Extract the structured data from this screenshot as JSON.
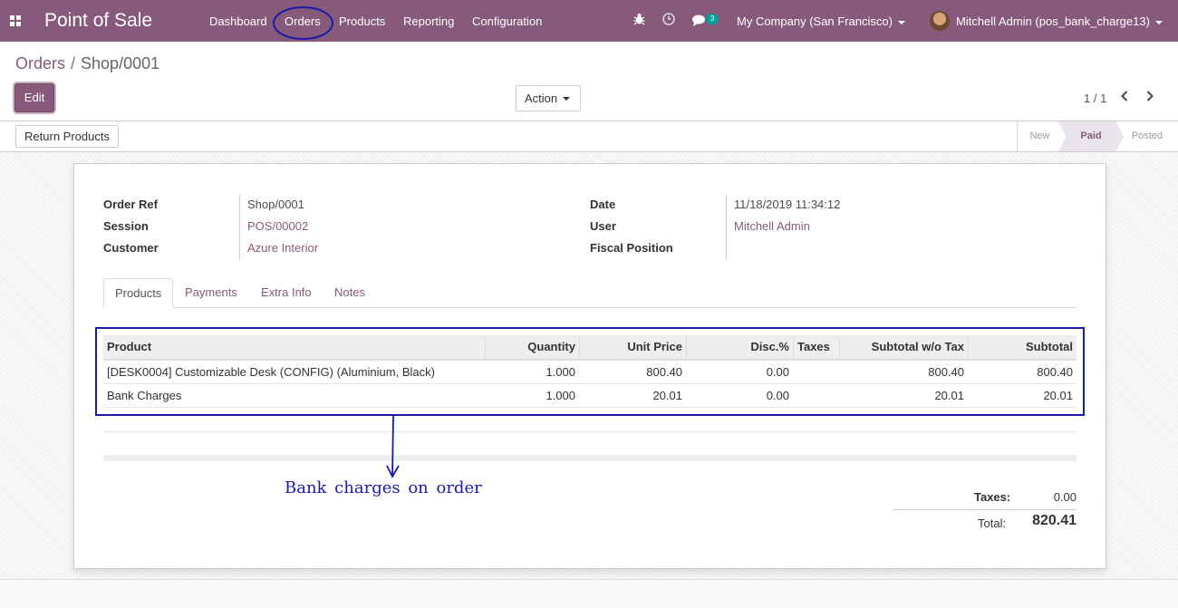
{
  "navbar": {
    "app_title": "Point of Sale",
    "menu": [
      "Dashboard",
      "Orders",
      "Products",
      "Reporting",
      "Configuration"
    ],
    "messages_count": "3",
    "company": "My Company (San Francisco)",
    "user": "Mitchell Admin (pos_bank_charge13)",
    "icons": [
      "apps-icon",
      "bug-icon",
      "clock-icon",
      "chat-icon"
    ]
  },
  "breadcrumb": {
    "parent": "Orders",
    "separator": "/",
    "current": "Shop/0001"
  },
  "toolbar": {
    "edit_label": "Edit",
    "action_label": "Action",
    "pager": "1 / 1",
    "prev_icon": "‹",
    "next_icon": "›"
  },
  "statusbar": {
    "return_label": "Return Products",
    "states": [
      "New",
      "Paid",
      "Posted"
    ],
    "active_state": "Paid"
  },
  "form": {
    "left": [
      {
        "label": "Order Ref",
        "value": "Shop/0001",
        "link": false
      },
      {
        "label": "Session",
        "value": "POS/00002",
        "link": true
      },
      {
        "label": "Customer",
        "value": "Azure Interior",
        "link": true
      }
    ],
    "right": [
      {
        "label": "Date",
        "value": "11/18/2019 11:34:12",
        "link": false
      },
      {
        "label": "User",
        "value": "Mitchell Admin",
        "link": true
      },
      {
        "label": "Fiscal Position",
        "value": "",
        "link": false
      }
    ]
  },
  "tabs": [
    "Products",
    "Payments",
    "Extra Info",
    "Notes"
  ],
  "active_tab": "Products",
  "table": {
    "headers": [
      "Product",
      "Quantity",
      "Unit Price",
      "Disc.%",
      "Taxes",
      "Subtotal w/o Tax",
      "Subtotal"
    ],
    "rows": [
      [
        "[DESK0004] Customizable Desk (CONFIG) (Aluminium, Black)",
        "1.000",
        "800.40",
        "0.00",
        "",
        "800.40",
        "800.40"
      ],
      [
        "Bank Charges",
        "1.000",
        "20.01",
        "0.00",
        "",
        "20.01",
        "20.01"
      ]
    ]
  },
  "totals": {
    "taxes_label": "Taxes:",
    "taxes_value": "0.00",
    "total_label": "Total:",
    "total_value": "820.41"
  },
  "annotation": {
    "text": "Bank charges on order",
    "color": "#1a1aa8"
  },
  "colors": {
    "brand": "#875a7b",
    "badge": "#00a09d"
  }
}
